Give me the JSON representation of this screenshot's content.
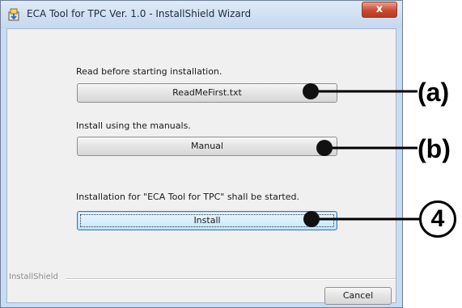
{
  "window": {
    "title": "ECA Tool for TPC Ver. 1.0 - InstallShield Wizard",
    "close_label": "x",
    "icon": "installer-icon"
  },
  "sections": [
    {
      "instruction": "Read before starting installation.",
      "button_label": "ReadMeFirst.txt",
      "callout": "(a)"
    },
    {
      "instruction": "Install using the manuals.",
      "button_label": "Manual",
      "callout": "(b)"
    },
    {
      "instruction": "Installation for \"ECA Tool for TPC\" shall be started.",
      "button_label": "Install",
      "callout": "4"
    }
  ],
  "footer": {
    "brand": "InstallShield",
    "cancel_label": "Cancel"
  },
  "colors": {
    "titlebar": "#c9dcf1",
    "client": "#f0f0f0",
    "close_button": "#c84b32",
    "focused_button": "#d9f0fc",
    "callout": "#000000"
  }
}
